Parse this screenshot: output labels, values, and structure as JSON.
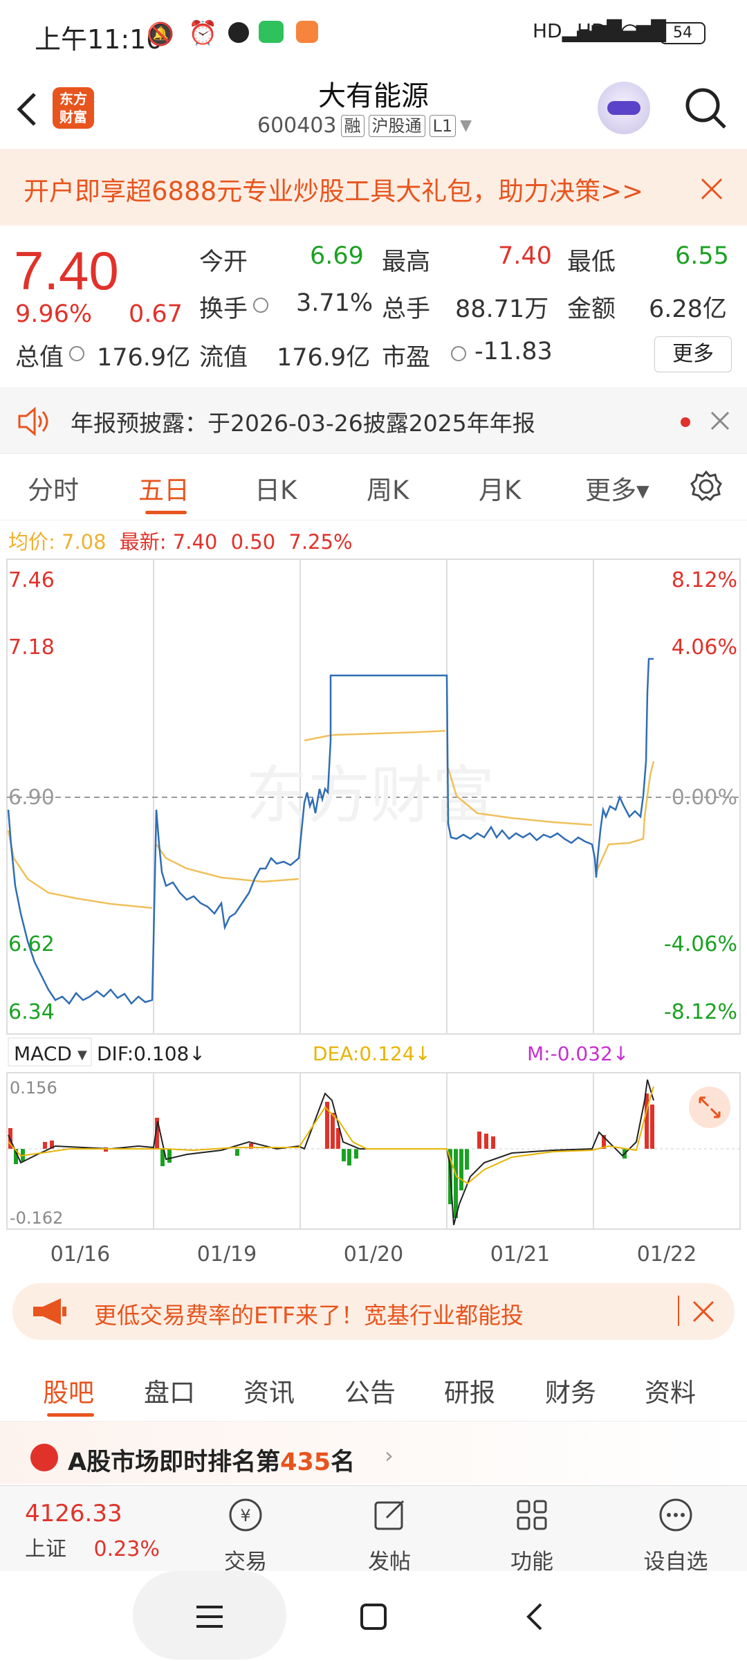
{
  "status_bar": {
    "time": "上午11:10",
    "battery": "54"
  },
  "header": {
    "title": "大有能源",
    "code": "600403",
    "tag_margin": "融",
    "tag_connect": "沪股通",
    "tag_level": "L1",
    "logo_text_line1": "东方",
    "logo_text_line2": "财富"
  },
  "promo": {
    "text": "开户即享超6888元专业炒股工具大礼包，助力决策>>"
  },
  "quote": {
    "price": "7.40",
    "change_pct": "9.96%",
    "change": "0.67",
    "open_label": "今开",
    "open": "6.69",
    "high_label": "最高",
    "high": "7.40",
    "low_label": "最低",
    "low": "6.55",
    "turnover_label": "换手",
    "turnover": "3.71%",
    "volume_label": "总手",
    "volume": "88.71万",
    "amount_label": "金额",
    "amount": "6.28亿",
    "mktcap_label": "总值",
    "mktcap": "176.9亿",
    "float_label": "流值",
    "float": "176.9亿",
    "pe_label": "市盈",
    "pe": "-11.83",
    "more_label": "更多"
  },
  "notice": {
    "text": "年报预披露：于2026-03-26披露2025年年报"
  },
  "tabs": [
    "分时",
    "五日",
    "日K",
    "周K",
    "月K",
    "更多▾"
  ],
  "avg": {
    "avg_label": "均价:",
    "avg": "7.08",
    "latest_label": "最新:",
    "latest": "7.40",
    "chg": "0.50",
    "chg_pct": "7.25%"
  },
  "chart": {
    "y_left": [
      "7.46",
      "7.18",
      "6.90",
      "6.62",
      "6.34"
    ],
    "y_right": [
      "8.12%",
      "4.06%",
      "0.00%",
      "-4.06%",
      "-8.12%"
    ],
    "watermark": "东方财富",
    "macd_label": "MACD",
    "dif": "DIF:0.108↓",
    "dea": "DEA:0.124↓",
    "m": "M:-0.032↓",
    "macd_max": "0.156",
    "macd_min": "-0.162",
    "dates": [
      "01/16",
      "01/19",
      "01/20",
      "01/21",
      "01/22"
    ],
    "colors": {
      "price": "#2f6db5",
      "avg": "#f0c05a",
      "up": "#e0322a",
      "down": "#1aa122"
    }
  },
  "bottom_ad": {
    "text": "更低交易费率的ETF来了！宽基行业都能投"
  },
  "subtabs": [
    "股吧",
    "盘口",
    "资讯",
    "公告",
    "研报",
    "财务",
    "资料"
  ],
  "rank": {
    "prefix": "A股市场即时排名第",
    "rank": "435",
    "suffix": "名"
  },
  "bottom_nav": {
    "index_value": "4126.33",
    "index_name": "上证",
    "index_chg": "0.23%",
    "trade": "交易",
    "post": "发帖",
    "func": "功能",
    "watch": "设自选"
  }
}
